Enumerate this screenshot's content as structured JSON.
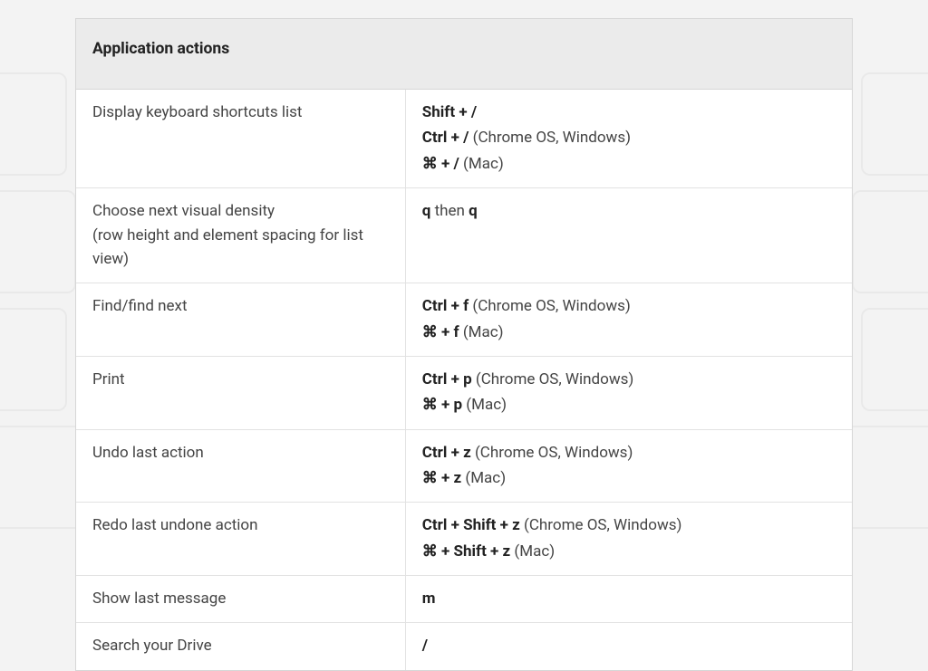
{
  "header": {
    "title": "Application actions"
  },
  "rows": [
    {
      "action": "Display keyboard shortcuts list",
      "action_sub": "",
      "shortcuts": [
        {
          "keys": "Shift + /",
          "context": ""
        },
        {
          "keys": "Ctrl + /",
          "context": " (Chrome OS, Windows)"
        },
        {
          "keys": "⌘ + /",
          "context": " (Mac)"
        }
      ]
    },
    {
      "action": "Choose next visual density",
      "action_sub": "(row height and element spacing for list view)",
      "shortcuts": [
        {
          "prefix": "q",
          "mid": " then ",
          "suffix": "q"
        }
      ]
    },
    {
      "action": "Find/find next",
      "action_sub": "",
      "shortcuts": [
        {
          "keys": "Ctrl + f",
          "context": " (Chrome OS, Windows)"
        },
        {
          "keys": "⌘ + f",
          "context": " (Mac)"
        }
      ]
    },
    {
      "action": "Print",
      "action_sub": "",
      "shortcuts": [
        {
          "keys": "Ctrl + p",
          "context": " (Chrome OS, Windows)"
        },
        {
          "keys": "⌘ + p",
          "context": " (Mac)"
        }
      ]
    },
    {
      "action": "Undo last action",
      "action_sub": "",
      "shortcuts": [
        {
          "keys": "Ctrl + z",
          "context": " (Chrome OS, Windows)"
        },
        {
          "keys": "⌘ + z",
          "context": " (Mac)"
        }
      ]
    },
    {
      "action": "Redo last undone action",
      "action_sub": "",
      "shortcuts": [
        {
          "keys": "Ctrl + Shift + z",
          "context": " (Chrome OS, Windows)"
        },
        {
          "keys": "⌘ + Shift + z",
          "context": " (Mac)"
        }
      ]
    },
    {
      "action": "Show last message",
      "action_sub": "",
      "shortcuts": [
        {
          "keys": "m",
          "context": ""
        }
      ]
    },
    {
      "action": "Search your Drive",
      "action_sub": "",
      "shortcuts": [
        {
          "keys": "/",
          "context": ""
        }
      ]
    }
  ]
}
